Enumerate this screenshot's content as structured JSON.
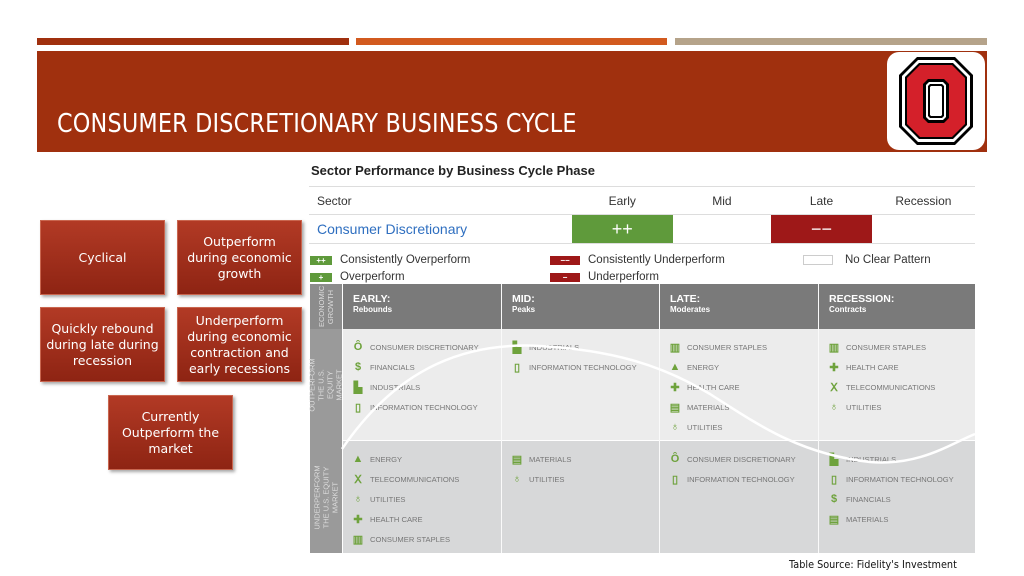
{
  "slide": {
    "title": "CONSUMER DISCRETIONARY BUSINESS CYCLE",
    "logo": "block-o-logo",
    "colors": {
      "banner": "#a0300e",
      "bar_orange": "#d25a1f",
      "bar_tan": "#b5a38a",
      "green": "#5f9a3b",
      "red": "#9e1818"
    }
  },
  "cards": [
    {
      "text": "Cyclical"
    },
    {
      "text": "Outperform during economic growth"
    },
    {
      "text": "Quickly rebound during late during recession"
    },
    {
      "text": "Underperform during economic contraction and early recessions"
    },
    {
      "text": "Currently Outperform the market"
    }
  ],
  "performance_table": {
    "title": "Sector Performance by Business Cycle Phase",
    "headers": [
      "Sector",
      "Early",
      "Mid",
      "Late",
      "Recession"
    ],
    "row": {
      "sector": "Consumer Discretionary",
      "early": "++",
      "mid": "",
      "late": "−−",
      "recession": ""
    }
  },
  "legend": [
    {
      "symbol": "++",
      "label": "Consistently Overperform",
      "color": "#5f9a3b"
    },
    {
      "symbol": "−−",
      "label": "Consistently Underperform",
      "color": "#9e1818"
    },
    {
      "symbol": "",
      "label": "No Clear Pattern",
      "color": "#ffffff"
    },
    {
      "symbol": "+",
      "label": "Overperform",
      "color": "#5f9a3b"
    },
    {
      "symbol": "−",
      "label": "Underperform",
      "color": "#9e1818"
    }
  ],
  "cycle_chart": {
    "side_labels": {
      "growth": "ECONOMIC GROWTH",
      "outperform": "OUTPERFORM THE U.S. EQUITY MARKET",
      "underperform": "UNDERPERFORM THE U.S. EQUITY MARKET"
    },
    "phases": [
      {
        "name": "EARLY:",
        "sub": "Rebounds",
        "outperform": [
          {
            "label": "CONSUMER DISCRETIONARY",
            "icon": "ring-icon"
          },
          {
            "label": "FINANCIALS",
            "icon": "dollar-icon"
          },
          {
            "label": "INDUSTRIALS",
            "icon": "factory-icon"
          },
          {
            "label": "INFORMATION TECHNOLOGY",
            "icon": "tablet-icon"
          }
        ],
        "underperform": [
          {
            "label": "ENERGY",
            "icon": "oil-rig-icon"
          },
          {
            "label": "TELECOMMUNICATIONS",
            "icon": "tower-icon"
          },
          {
            "label": "UTILITIES",
            "icon": "lightbulb-icon"
          },
          {
            "label": "HEALTH CARE",
            "icon": "medical-cross-icon"
          },
          {
            "label": "CONSUMER STAPLES",
            "icon": "cart-icon"
          }
        ]
      },
      {
        "name": "MID:",
        "sub": "Peaks",
        "outperform": [
          {
            "label": "INDUSTRIALS",
            "icon": "factory-icon"
          },
          {
            "label": "INFORMATION TECHNOLOGY",
            "icon": "tablet-icon"
          }
        ],
        "underperform": [
          {
            "label": "MATERIALS",
            "icon": "mine-cart-icon"
          },
          {
            "label": "UTILITIES",
            "icon": "lightbulb-icon"
          }
        ]
      },
      {
        "name": "LATE:",
        "sub": "Moderates",
        "outperform": [
          {
            "label": "CONSUMER STAPLES",
            "icon": "cart-icon"
          },
          {
            "label": "ENERGY",
            "icon": "oil-rig-icon"
          },
          {
            "label": "HEALTH CARE",
            "icon": "medical-cross-icon"
          },
          {
            "label": "MATERIALS",
            "icon": "mine-cart-icon"
          },
          {
            "label": "UTILITIES",
            "icon": "lightbulb-icon"
          }
        ],
        "underperform": [
          {
            "label": "CONSUMER DISCRETIONARY",
            "icon": "ring-icon"
          },
          {
            "label": "INFORMATION TECHNOLOGY",
            "icon": "tablet-icon"
          }
        ]
      },
      {
        "name": "RECESSION:",
        "sub": "Contracts",
        "outperform": [
          {
            "label": "CONSUMER STAPLES",
            "icon": "cart-icon"
          },
          {
            "label": "HEALTH CARE",
            "icon": "medical-cross-icon"
          },
          {
            "label": "TELECOMMUNICATIONS",
            "icon": "tower-icon"
          },
          {
            "label": "UTILITIES",
            "icon": "lightbulb-icon"
          }
        ],
        "underperform": [
          {
            "label": "INDUSTRIALS",
            "icon": "factory-icon"
          },
          {
            "label": "INFORMATION TECHNOLOGY",
            "icon": "tablet-icon"
          },
          {
            "label": "FINANCIALS",
            "icon": "dollar-icon"
          },
          {
            "label": "MATERIALS",
            "icon": "mine-cart-icon"
          }
        ]
      }
    ]
  },
  "source": "Table Source: Fidelity's Investment"
}
